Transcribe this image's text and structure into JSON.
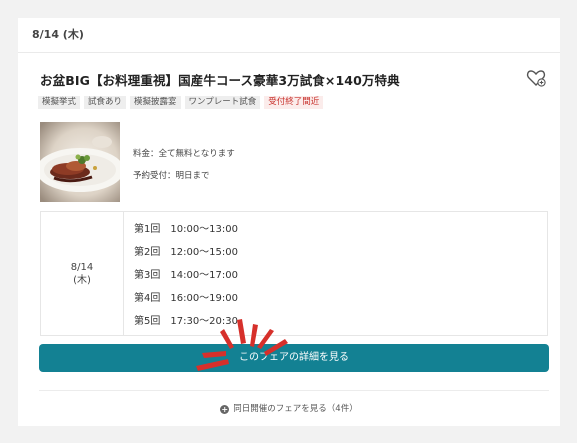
{
  "card": {
    "date": "8/14 (木)",
    "title": "お盆BIG【お料理重視】国産牛コース豪華3万試食×140万特典",
    "tags": [
      {
        "label": "模擬挙式",
        "style": "normal"
      },
      {
        "label": "試食あり",
        "style": "normal"
      },
      {
        "label": "模擬披露宴",
        "style": "normal"
      },
      {
        "label": "ワンプレート試食",
        "style": "normal"
      },
      {
        "label": "受付終了間近",
        "style": "red"
      }
    ],
    "fee": "料金：全て無料となります",
    "reservation": "予約受付：明日まで",
    "schedule": {
      "date": "8/14",
      "weekday": "(木)",
      "slots": [
        "第1回　10:00〜13:00",
        "第2回　12:00〜15:00",
        "第3回　14:00〜17:00",
        "第4回　16:00〜19:00",
        "第5回　17:30〜20:30"
      ]
    },
    "cta_label": "このフェアの詳細を見る",
    "same_day_label": "同日開催のフェアを見る（4件）"
  },
  "colors": {
    "cta": "#138193",
    "tag_red_text": "#c8322d",
    "burst": "#d6302b"
  },
  "icons": [
    "heart-plus-icon",
    "plus-circle-icon"
  ]
}
